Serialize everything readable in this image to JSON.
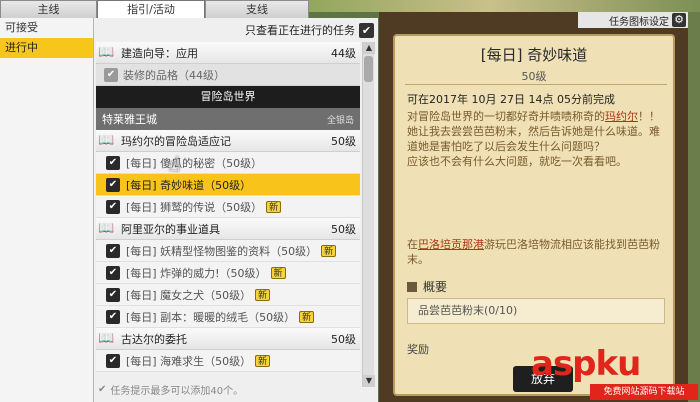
{
  "tabs": [
    {
      "label": "主线"
    },
    {
      "label": "指引/活动"
    },
    {
      "label": "支线"
    }
  ],
  "categories": [
    {
      "label": "可接受"
    },
    {
      "label": "进行中"
    }
  ],
  "filter": {
    "label": "只查看正在进行的任务"
  },
  "groups": [
    {
      "name": "建造向导：应用",
      "level": "44级"
    },
    {
      "name": "玛约尔的冒险岛适应记",
      "level": "50级"
    },
    {
      "name": "阿里亚尔的事业道具",
      "level": "50级"
    },
    {
      "name": "古达尔的委托",
      "level": "50级"
    }
  ],
  "sub_item": {
    "label": "装修的品格（44级）"
  },
  "region": {
    "label": "冒险岛世界"
  },
  "area": {
    "label": "特莱雅王城",
    "coin": "全银岛"
  },
  "items": [
    {
      "name": "[每日] 傻瓜的秘密（50级）"
    },
    {
      "name": "[每日] 奇妙味道（50级）"
    },
    {
      "name": "[每日] 狮鹫的传说（50级）",
      "badge": "新"
    },
    {
      "name": "[每日] 妖精型怪物图鉴的资料（50级）",
      "badge": "新"
    },
    {
      "name": "[每日] 炸弹的威力!（50级）",
      "badge": "新"
    },
    {
      "name": "[每日] 魔女之犬（50级）",
      "badge": "新"
    },
    {
      "name": "[每日] 副本：暖暖的绒毛（50级）",
      "badge": "新"
    },
    {
      "name": "[每日] 海难求生（50级）",
      "badge": "新"
    }
  ],
  "footer": {
    "text": "任务提示最多可以添加40个。"
  },
  "settings": {
    "label": "任务图标设定"
  },
  "detail": {
    "title": "[每日] 奇妙味道",
    "level": "50级",
    "timer": "可在2017年 10月 27日 14点 05分前完成",
    "desc_a": "对冒险岛世界的一切都好奇并啧啧称奇的",
    "desc_b": "玛约尔",
    "desc_c": "！！",
    "desc_d": "她让我去尝尝芭芭粉末，然后告诉她是什么味道。难道她是害怕吃了以后会发生什么问题吗？",
    "desc_e": "应该也不会有什么大问题，就吃一次看看吧。",
    "desc2_a": "在",
    "desc2_b": "巴洛培贡那港",
    "desc2_c": "游玩巴洛培物流相应该能找到芭芭粉末。",
    "summary_label": "概要",
    "summary_value": "品尝芭芭粉末(0/10)",
    "reward_label": "奖励",
    "abandon_label": "放弃"
  },
  "watermark": {
    "main": "aspku",
    "sub_a": ".com",
    "sub_b": "免费网站源码下载站"
  }
}
